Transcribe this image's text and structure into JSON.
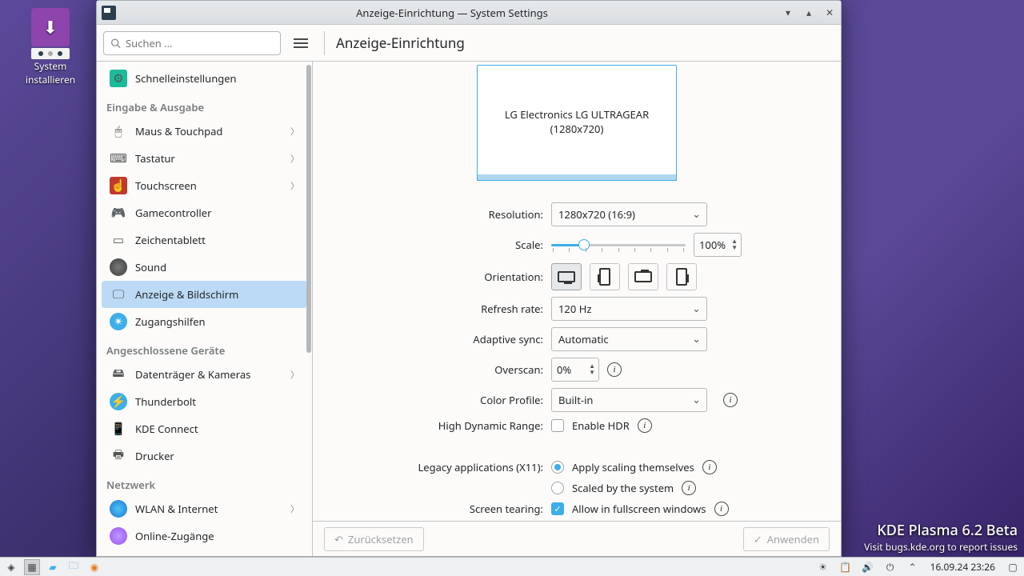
{
  "desktop": {
    "icon_label_1": "System",
    "icon_label_2": "installieren"
  },
  "window": {
    "title": "Anzeige-Einrichtung — System Settings",
    "search_placeholder": "Suchen …",
    "page_title": "Anzeige-Einrichtung"
  },
  "sidebar": {
    "quicksettings": "Schnelleinstellungen",
    "cat_io": "Eingabe & Ausgabe",
    "mouse": "Maus & Touchpad",
    "keyboard": "Tastatur",
    "touchscreen": "Touchscreen",
    "gamecontroller": "Gamecontroller",
    "tablet": "Zeichentablett",
    "sound": "Sound",
    "display": "Anzeige & Bildschirm",
    "access": "Zugangshilfen",
    "cat_devices": "Angeschlossene Geräte",
    "disks": "Datenträger & Kameras",
    "thunderbolt": "Thunderbolt",
    "kdeconnect": "KDE Connect",
    "printer": "Drucker",
    "cat_network": "Netzwerk",
    "wifi": "WLAN & Internet",
    "online": "Online-Zugänge"
  },
  "preview": {
    "monitor_name": "LG Electronics LG ULTRAGEAR",
    "monitor_res": "(1280x720)"
  },
  "form": {
    "resolution_label": "Resolution:",
    "resolution_value": "1280x720 (16:9)",
    "scale_label": "Scale:",
    "scale_value": "100%",
    "orientation_label": "Orientation:",
    "refresh_label": "Refresh rate:",
    "refresh_value": "120 Hz",
    "adaptive_label": "Adaptive sync:",
    "adaptive_value": "Automatic",
    "overscan_label": "Overscan:",
    "overscan_value": "0%",
    "colorprofile_label": "Color Profile:",
    "colorprofile_value": "Built-in",
    "hdr_label": "High Dynamic Range:",
    "hdr_check": "Enable HDR",
    "legacy_label": "Legacy applications (X11):",
    "legacy_opt1": "Apply scaling themselves",
    "legacy_opt2": "Scaled by the system",
    "tearing_label": "Screen tearing:",
    "tearing_check": "Allow in fullscreen windows"
  },
  "footer": {
    "reset": "Zurücksetzen",
    "apply": "Anwenden"
  },
  "overlay": {
    "title": "KDE Plasma 6.2 Beta",
    "subtitle": "Visit bugs.kde.org to report issues"
  },
  "taskbar": {
    "datetime": "16.09.24 23:26"
  }
}
